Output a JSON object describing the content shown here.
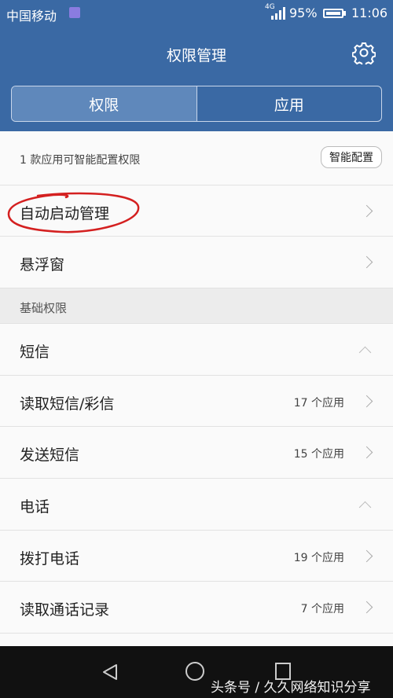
{
  "status_bar": {
    "carrier": "中国移动",
    "network": "4G",
    "battery": "95%",
    "time": "11:06"
  },
  "header": {
    "title": "权限管理"
  },
  "tabs": [
    {
      "label": "权限",
      "active": true
    },
    {
      "label": "应用",
      "active": false
    }
  ],
  "smart_config": {
    "info": "1 款应用可智能配置权限",
    "button": "智能配置"
  },
  "top_items": [
    {
      "label": "自动启动管理"
    },
    {
      "label": "悬浮窗"
    }
  ],
  "basic_section": {
    "label": "基础权限"
  },
  "sms_group": {
    "label": "短信",
    "items": [
      {
        "label": "读取短信/彩信",
        "count": "17 个应用"
      },
      {
        "label": "发送短信",
        "count": "15 个应用"
      }
    ]
  },
  "phone_group": {
    "label": "电话",
    "items": [
      {
        "label": "拨打电话",
        "count": "19 个应用"
      },
      {
        "label": "读取通话记录",
        "count": "7 个应用"
      }
    ]
  },
  "watermark": "头条号 / 久久网络知识分享",
  "colors": {
    "header_bg": "#3a69a4",
    "active_tab_bg": "#5f88bb",
    "annotation_circle": "#d42020"
  }
}
